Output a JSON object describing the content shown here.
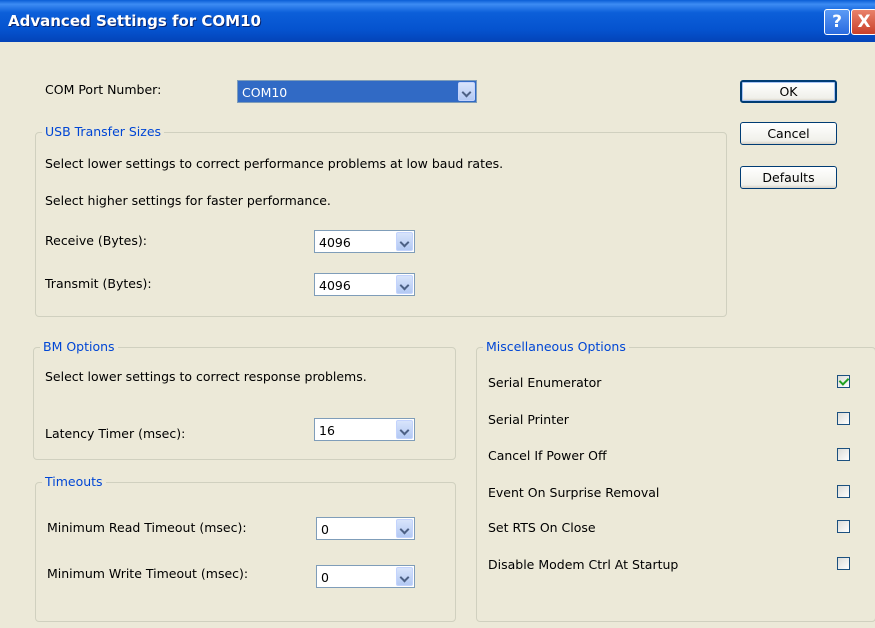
{
  "window": {
    "title": "Advanced Settings for COM10",
    "help_glyph": "?",
    "close_glyph": "X"
  },
  "com_port": {
    "label": "COM Port Number:",
    "value": "COM10"
  },
  "buttons": {
    "ok": "OK",
    "cancel": "Cancel",
    "defaults": "Defaults"
  },
  "usb_transfer": {
    "legend": "USB Transfer Sizes",
    "desc1": "Select lower settings to correct performance problems at low baud rates.",
    "desc2": "Select higher settings for faster performance.",
    "receive_label": "Receive (Bytes):",
    "receive_value": "4096",
    "transmit_label": "Transmit (Bytes):",
    "transmit_value": "4096"
  },
  "bm_options": {
    "legend": "BM Options",
    "desc": "Select lower settings to correct response problems.",
    "latency_label": "Latency Timer (msec):",
    "latency_value": "16"
  },
  "timeouts": {
    "legend": "Timeouts",
    "read_label": "Minimum Read Timeout (msec):",
    "read_value": "0",
    "write_label": "Minimum Write Timeout (msec):",
    "write_value": "0"
  },
  "misc": {
    "legend": "Miscellaneous Options",
    "items": [
      {
        "label": "Serial Enumerator",
        "checked": true
      },
      {
        "label": "Serial Printer",
        "checked": false
      },
      {
        "label": "Cancel If Power Off",
        "checked": false
      },
      {
        "label": "Event On Surprise Removal",
        "checked": false
      },
      {
        "label": "Set RTS On Close",
        "checked": false
      },
      {
        "label": "Disable Modem Ctrl At Startup",
        "checked": false
      }
    ]
  },
  "colors": {
    "titlebar": "#0553cf",
    "dialog_bg": "#ece9d8",
    "legend_text": "#0046d5",
    "selection": "#316ac5"
  }
}
